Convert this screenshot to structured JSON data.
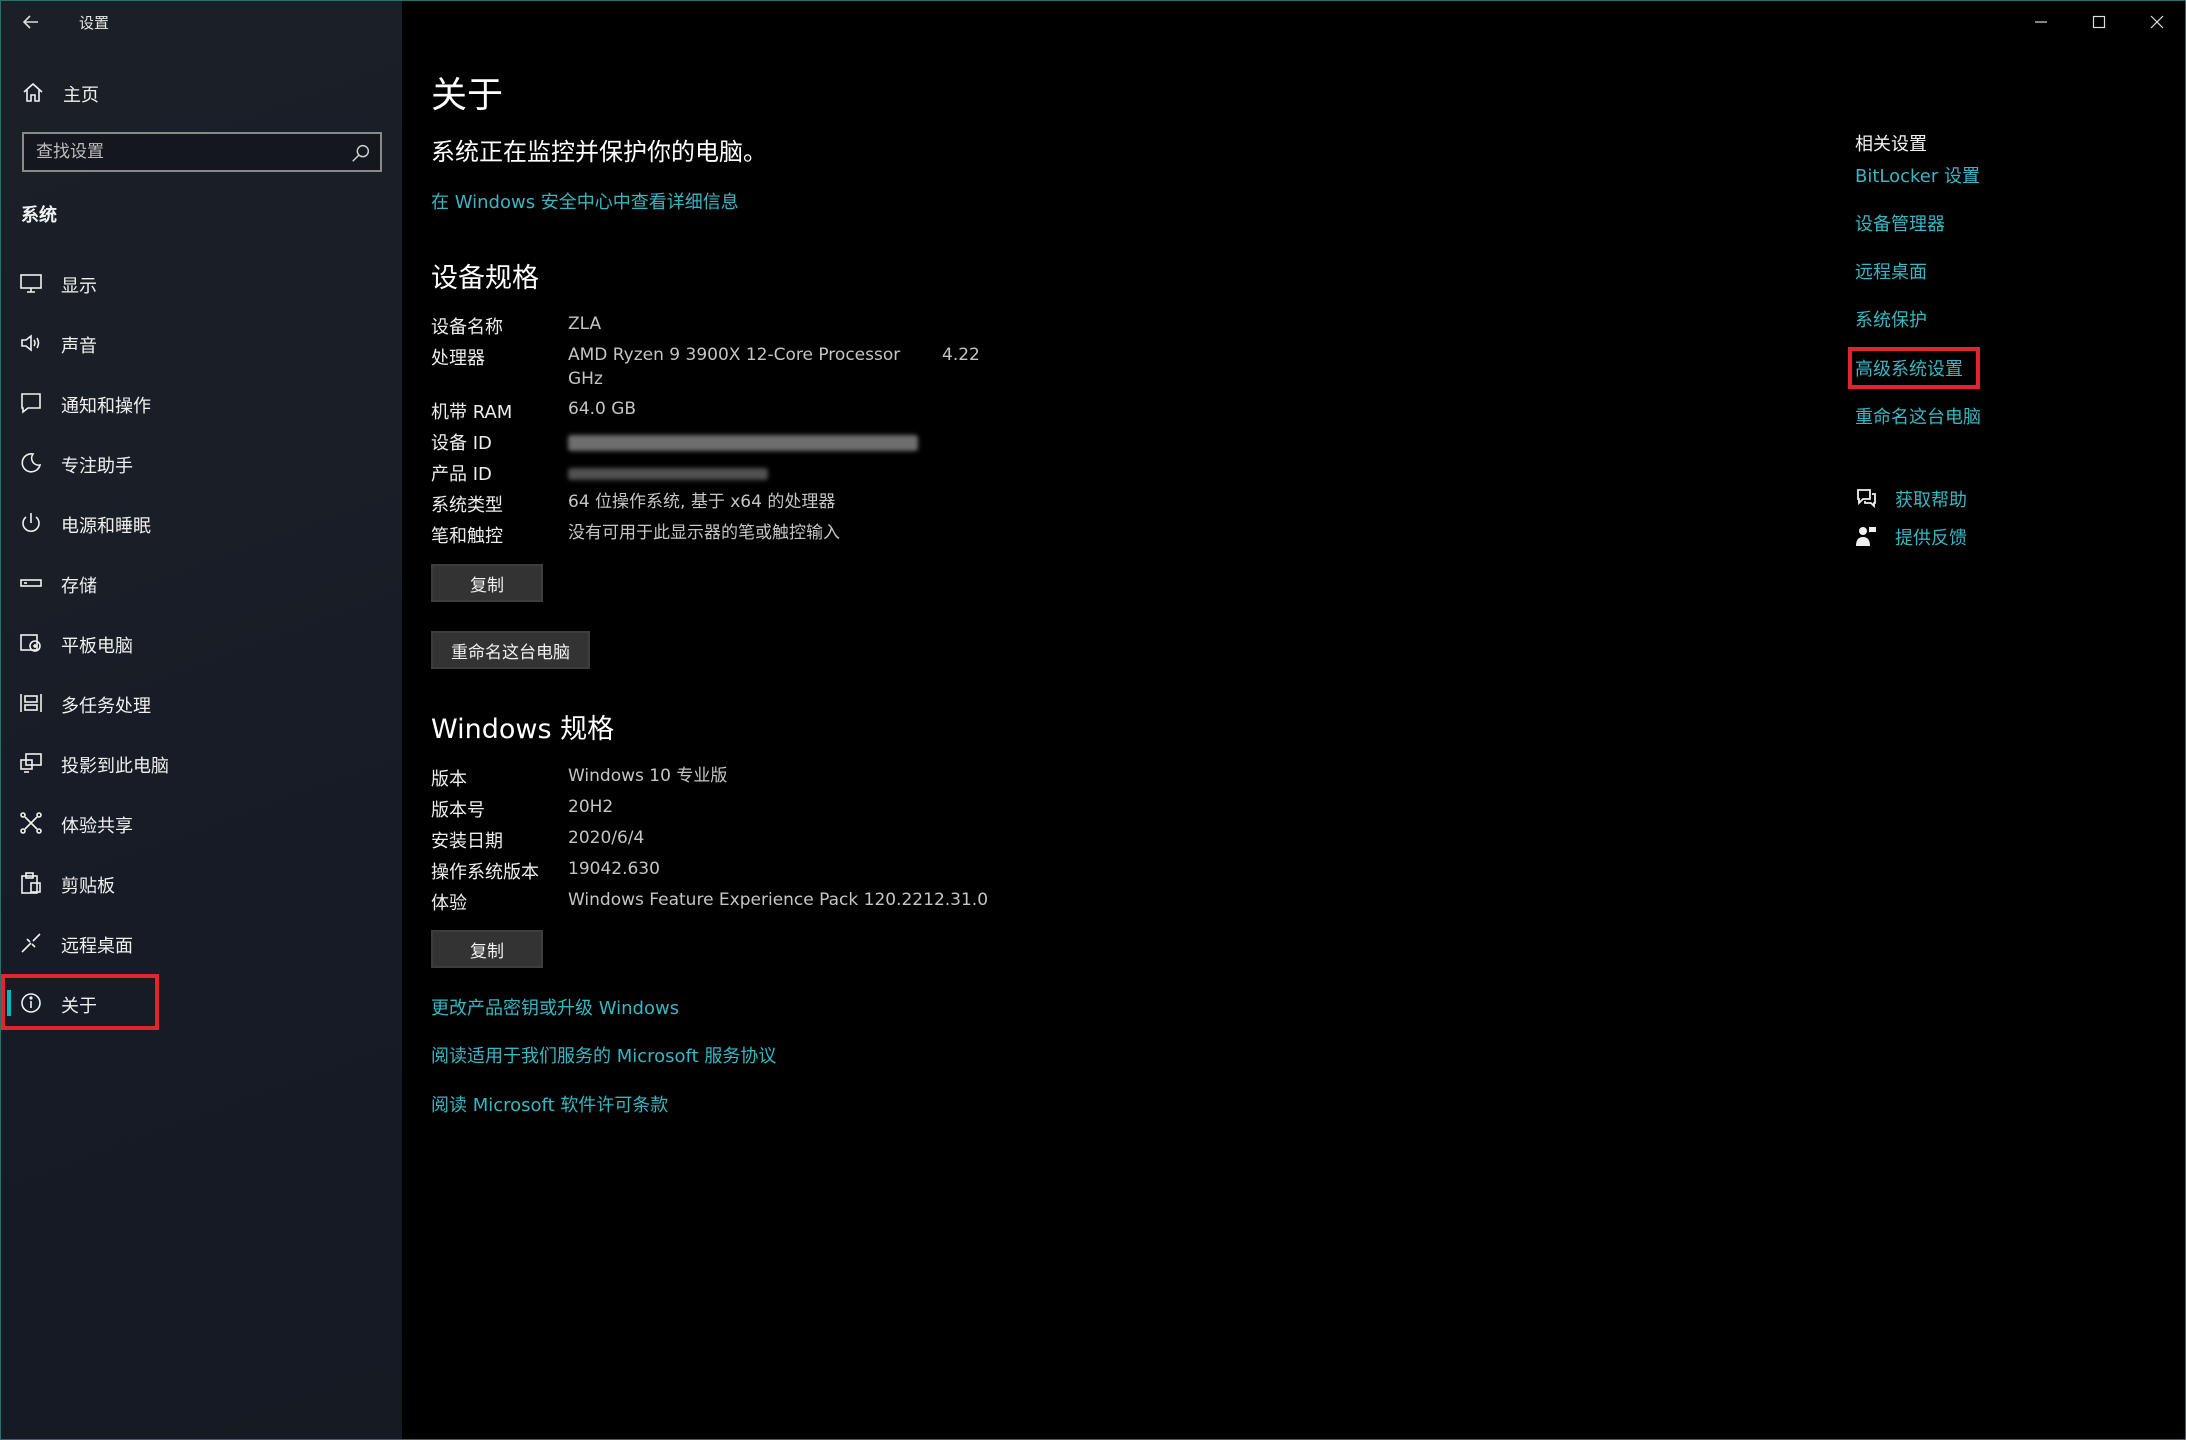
{
  "window": {
    "title": "设置"
  },
  "sidebar": {
    "home_label": "主页",
    "search_placeholder": "查找设置",
    "section_label": "系统",
    "items": [
      {
        "label": "显示",
        "icon": "monitor-icon"
      },
      {
        "label": "声音",
        "icon": "speaker-icon"
      },
      {
        "label": "通知和操作",
        "icon": "notification-icon"
      },
      {
        "label": "专注助手",
        "icon": "moon-icon"
      },
      {
        "label": "电源和睡眠",
        "icon": "power-icon"
      },
      {
        "label": "存储",
        "icon": "storage-icon"
      },
      {
        "label": "平板电脑",
        "icon": "tablet-icon"
      },
      {
        "label": "多任务处理",
        "icon": "multitask-icon"
      },
      {
        "label": "投影到此电脑",
        "icon": "project-icon"
      },
      {
        "label": "体验共享",
        "icon": "share-icon"
      },
      {
        "label": "剪贴板",
        "icon": "clipboard-icon"
      },
      {
        "label": "远程桌面",
        "icon": "remote-desktop-icon"
      },
      {
        "label": "关于",
        "icon": "info-icon",
        "selected": true
      }
    ]
  },
  "main": {
    "title": "关于",
    "protect_text": "系统正在监控并保护你的电脑。",
    "security_link": "在 Windows 安全中心中查看详细信息",
    "device_specs": {
      "title": "设备规格",
      "rows": [
        {
          "label": "设备名称",
          "value": "ZLA"
        },
        {
          "label": "处理器",
          "value": "AMD Ryzen 9 3900X 12-Core Processor",
          "value_extra": "4.22",
          "value_line2": "GHz"
        },
        {
          "label": "机带 RAM",
          "value": "64.0 GB"
        },
        {
          "label": "设备 ID",
          "value": ""
        },
        {
          "label": "产品 ID",
          "value": ""
        },
        {
          "label": "系统类型",
          "value": "64 位操作系统, 基于 x64 的处理器"
        },
        {
          "label": "笔和触控",
          "value": "没有可用于此显示器的笔或触控输入"
        }
      ],
      "copy_button": "复制",
      "rename_button": "重命名这台电脑"
    },
    "windows_specs": {
      "title": "Windows 规格",
      "rows": [
        {
          "label": "版本",
          "value": "Windows 10 专业版"
        },
        {
          "label": "版本号",
          "value": "20H2"
        },
        {
          "label": "安装日期",
          "value": "2020/6/4"
        },
        {
          "label": "操作系统版本",
          "value": "19042.630"
        },
        {
          "label": "体验",
          "value": "Windows Feature Experience Pack 120.2212.31.0"
        }
      ],
      "copy_button": "复制"
    },
    "bottom_links": [
      "更改产品密钥或升级 Windows",
      "阅读适用于我们服务的 Microsoft 服务协议",
      "阅读 Microsoft 软件许可条款"
    ]
  },
  "related": {
    "title": "相关设置",
    "links": [
      "BitLocker 设置",
      "设备管理器",
      "远程桌面",
      "系统保护",
      "高级系统设置",
      "重命名这台电脑"
    ],
    "help_label": "获取帮助",
    "feedback_label": "提供反馈"
  },
  "colors": {
    "accent": "#36b7c3",
    "highlight": "#e0262c",
    "sidebar_bg": "#1a1e27",
    "main_bg": "#000000"
  }
}
